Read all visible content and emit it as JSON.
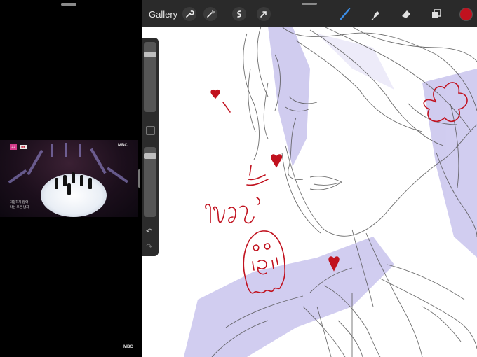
{
  "toolbar": {
    "gallery_label": "Gallery",
    "icons": [
      "wrench-icon",
      "magic-wand-icon",
      "selection-icon",
      "transform-arrow-icon",
      "brush-icon",
      "smudge-icon",
      "eraser-icon",
      "layers-icon",
      "color-swatch-icon"
    ],
    "active_tool": "brush",
    "current_color": "#c1121f"
  },
  "sidebar": {
    "brush_size_level": 0.85,
    "opacity_level": 0.9
  },
  "video": {
    "logo_text": "MBC",
    "corner_logo_text": "MBC",
    "subtitle_line1": "저항하지 않아",
    "subtitle_line2": "나는 모든 남자"
  },
  "canvas": {
    "sketch_text": "เข้าว่า",
    "ink_color": "#c1121f",
    "pencil_color": "#555555",
    "shade_color": "#b8b2e8"
  }
}
